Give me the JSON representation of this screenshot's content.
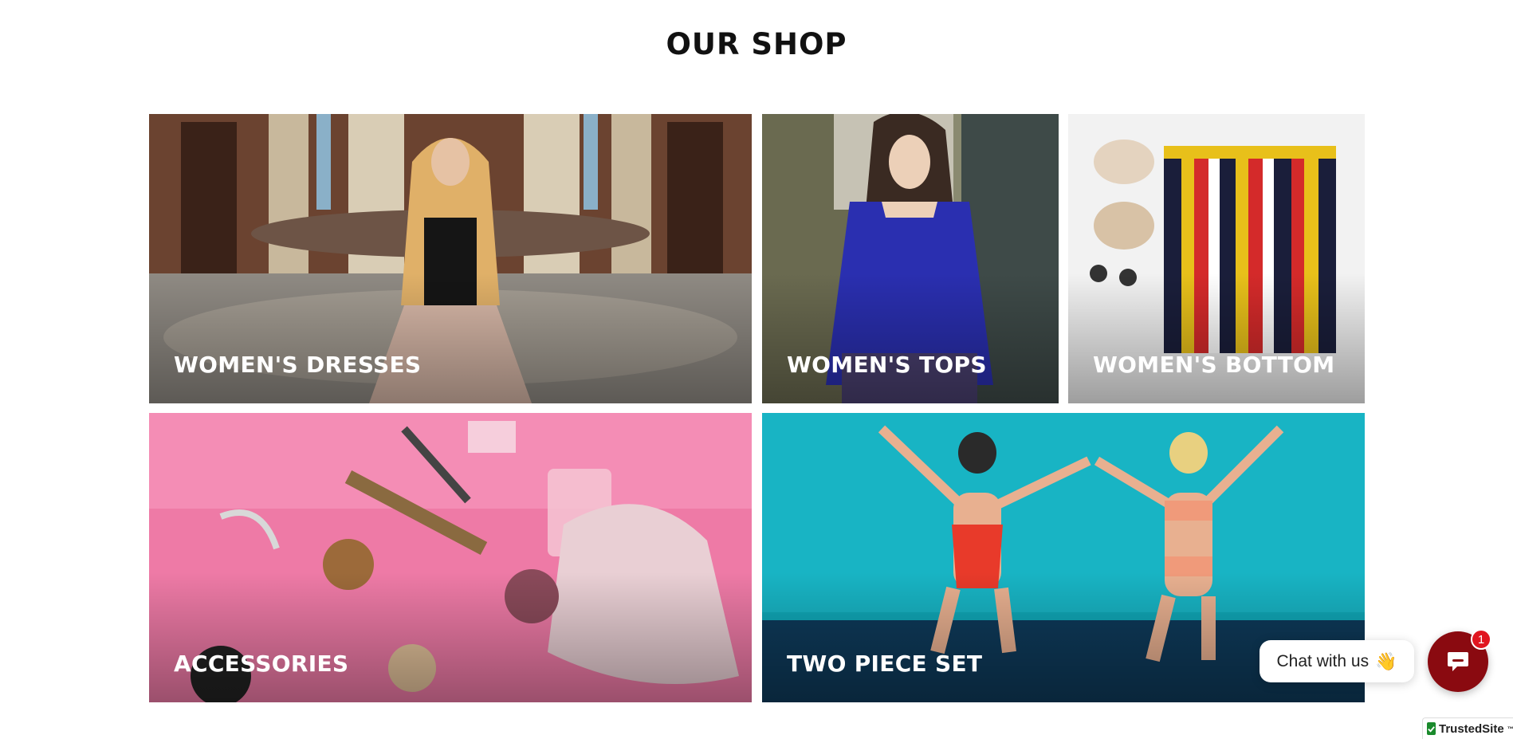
{
  "page": {
    "title": "OUR SHOP"
  },
  "categories": [
    {
      "label": "WOMEN'S DRESSES"
    },
    {
      "label": "WOMEN'S TOPS"
    },
    {
      "label": "WOMEN'S BOTTOM"
    },
    {
      "label": "ACCESSORIES"
    },
    {
      "label": "TWO PIECE SET"
    }
  ],
  "chat": {
    "prompt": "Chat with us",
    "wave_icon": "👋",
    "unread_count": "1",
    "launcher_icon": "chat-bubble-icon",
    "accent_color": "#8a0a10",
    "badge_color": "#e0151f"
  },
  "trust_badge": {
    "label": "TrustedSite",
    "mark": "™"
  }
}
